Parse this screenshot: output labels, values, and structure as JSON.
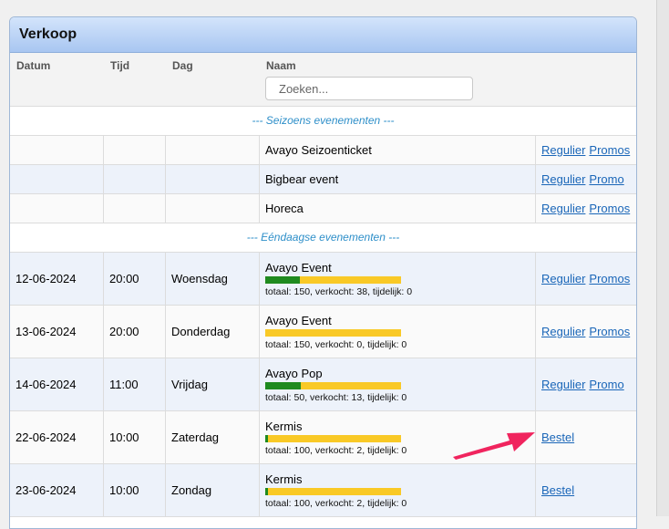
{
  "panel": {
    "title": "Verkoop"
  },
  "columns": {
    "datum": "Datum",
    "tijd": "Tijd",
    "dag": "Dag",
    "naam": "Naam"
  },
  "search": {
    "placeholder": "Zoeken..."
  },
  "sections": {
    "seasonal": "--- Seizoens evenementen ---",
    "single": "--- Eéndaagse evenementen ---"
  },
  "seasonal_rows": [
    {
      "name": "Avayo Seizoenticket",
      "links": [
        "Regulier",
        "Promos"
      ]
    },
    {
      "name": "Bigbear event",
      "links": [
        "Regulier",
        "Promo"
      ]
    },
    {
      "name": "Horeca",
      "links": [
        "Regulier",
        "Promos"
      ]
    }
  ],
  "event_rows": [
    {
      "date": "12-06-2024",
      "time": "20:00",
      "day": "Woensdag",
      "name": "Avayo Event",
      "stats": "totaal: 150, verkocht: 38, tijdelijk: 0",
      "sold_fraction": 0.2533,
      "links": [
        "Regulier",
        "Promos"
      ]
    },
    {
      "date": "13-06-2024",
      "time": "20:00",
      "day": "Donderdag",
      "name": "Avayo Event",
      "stats": "totaal: 150, verkocht: 0, tijdelijk: 0",
      "sold_fraction": 0.0,
      "links": [
        "Regulier",
        "Promos"
      ]
    },
    {
      "date": "14-06-2024",
      "time": "11:00",
      "day": "Vrijdag",
      "name": "Avayo Pop",
      "stats": "totaal: 50, verkocht: 13, tijdelijk: 0",
      "sold_fraction": 0.26,
      "links": [
        "Regulier",
        "Promo"
      ]
    },
    {
      "date": "22-06-2024",
      "time": "10:00",
      "day": "Zaterdag",
      "name": "Kermis",
      "stats": "totaal: 100, verkocht: 2, tijdelijk: 0",
      "sold_fraction": 0.02,
      "links": [
        "Bestel"
      ]
    },
    {
      "date": "23-06-2024",
      "time": "10:00",
      "day": "Zondag",
      "name": "Kermis",
      "stats": "totaal: 100, verkocht: 2, tijdelijk: 0",
      "sold_fraction": 0.02,
      "links": [
        "Bestel"
      ]
    }
  ],
  "colors": {
    "accent_header": "#a8c6f1",
    "bar_sold": "#1f8a1f",
    "bar_remaining": "#f9c926",
    "link": "#1a66b8",
    "arrow": "#f0245e"
  }
}
